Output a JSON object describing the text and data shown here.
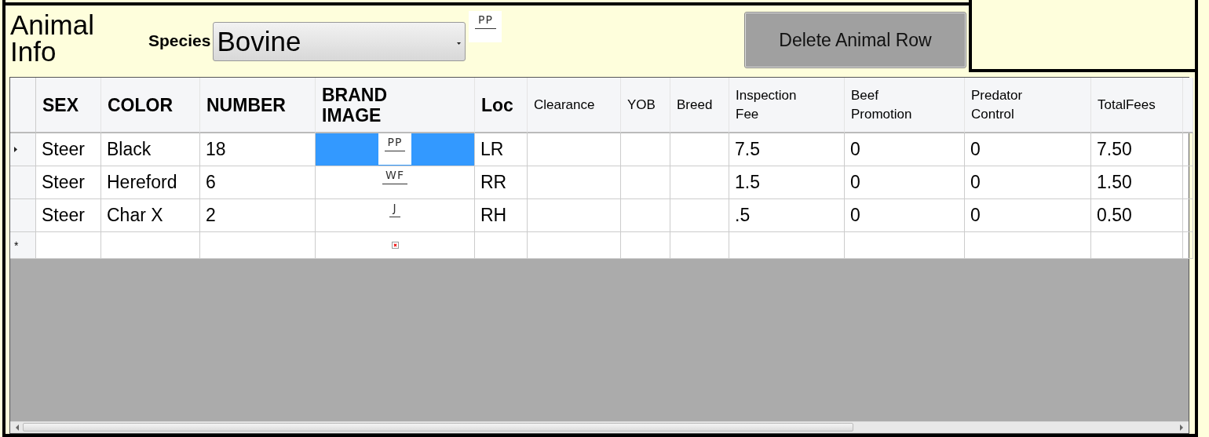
{
  "panel": {
    "title": "Animal Info",
    "species_label": "Species",
    "species": {
      "value": "Bovine"
    },
    "species_brand": "PP",
    "delete_button": "Delete Animal Row"
  },
  "table": {
    "columns": [
      {
        "label": "SEX",
        "kind": "large"
      },
      {
        "label": "COLOR",
        "kind": "large"
      },
      {
        "label": "NUMBER",
        "kind": "large"
      },
      {
        "label": "BRAND IMAGE",
        "kind": "image"
      },
      {
        "label": "Loc",
        "kind": "large"
      },
      {
        "label": "Clearance",
        "kind": "small"
      },
      {
        "label": "YOB",
        "kind": "small"
      },
      {
        "label": "Breed",
        "kind": "small"
      },
      {
        "label": "Inspection Fee",
        "kind": "small"
      },
      {
        "label": "Beef Promotion",
        "kind": "small"
      },
      {
        "label": "Predator Control",
        "kind": "small"
      },
      {
        "label": "TotalFees",
        "kind": "small"
      }
    ],
    "rows": [
      {
        "kind": "data",
        "selected": true,
        "cells": [
          "Steer",
          "Black",
          "18",
          "PP",
          "LR",
          "",
          "",
          "",
          "7.5",
          "0",
          "0",
          "7.50"
        ]
      },
      {
        "kind": "data",
        "selected": false,
        "cells": [
          "Steer",
          "Hereford",
          "6",
          "WF",
          "RR",
          "",
          "",
          "",
          "1.5",
          "0",
          "0",
          "1.50"
        ]
      },
      {
        "kind": "data",
        "selected": false,
        "cells": [
          "Steer",
          "Char X",
          "2",
          "J",
          "RH",
          "",
          "",
          "",
          ".5",
          "0",
          "0",
          "0.50"
        ]
      },
      {
        "kind": "new",
        "selected": false,
        "marker": "*"
      }
    ]
  }
}
